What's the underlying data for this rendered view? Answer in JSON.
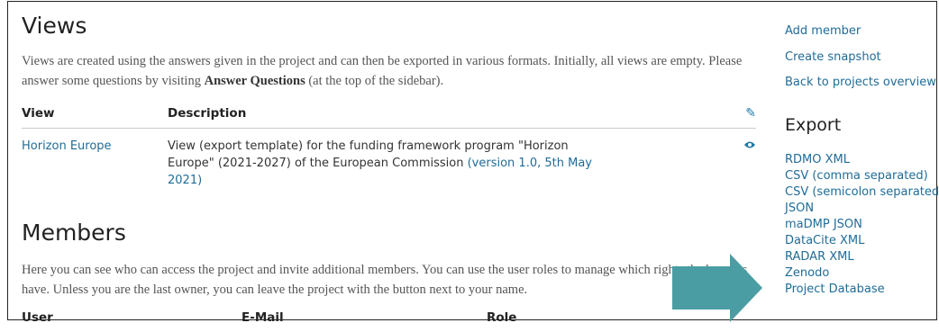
{
  "views": {
    "heading": "Views",
    "intro_before": "Views are created using the answers given in the project and can then be exported in various formats. Initially, all views are empty. Please answer some questions by visiting ",
    "intro_bold": "Answer Questions",
    "intro_after": " (at the top of the sidebar).",
    "table": {
      "col_view": "View",
      "col_description": "Description",
      "header_icon": "pencil-icon",
      "row": {
        "name": "Horizon Europe",
        "description": "View (export template) for the funding framework program \"Horizon Europe\" (2021-2027) of the European Commission ",
        "version_link": "(version 1.0, 5th May 2021)",
        "action_icon": "eye-icon"
      }
    }
  },
  "members": {
    "heading": "Members",
    "intro": "Here you can see who can access the project and invite additional members. You can use the user roles to manage which rights the benefits have. Unless you are the last owner, you can leave the project with the button next to your name.",
    "col_user": "User",
    "col_email": "E-Mail",
    "col_role": "Role"
  },
  "sidebar": {
    "links": [
      "Add member",
      "Create snapshot",
      "Back to projects overview"
    ],
    "export_heading": "Export",
    "export_links": [
      "RDMO XML",
      "CSV (comma separated)",
      "CSV (semicolon separated)",
      "JSON",
      "maDMP JSON",
      "DataCite XML",
      "RADAR XML",
      "Zenodo",
      "Project Database"
    ]
  },
  "colors": {
    "link": "#1f6c98",
    "arrow": "#4a9ea3",
    "text": "#222222"
  }
}
